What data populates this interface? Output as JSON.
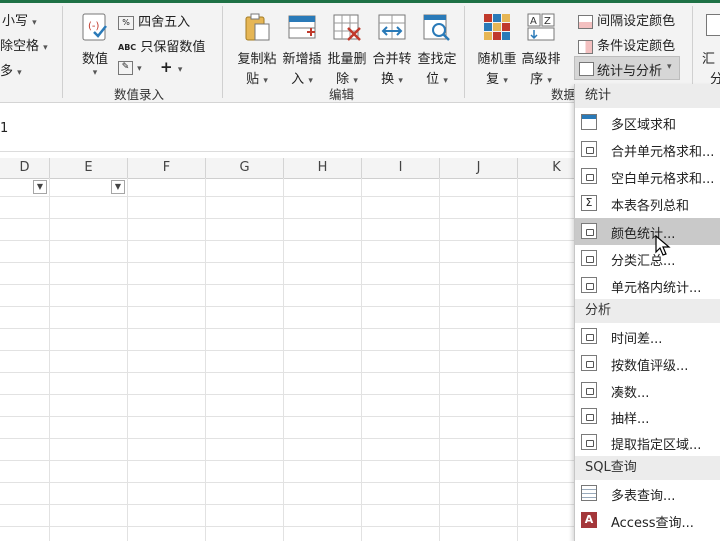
{
  "ribbon": {
    "left_partial": {
      "row1": "小写",
      "row2": "除空格",
      "row3": "多"
    },
    "numeric_group": {
      "value_button": "数值",
      "round_label": "四舍五入",
      "keep_value_label": "只保留数值",
      "plus": "+",
      "group_label": "数值录入"
    },
    "edit_group": {
      "buttons": [
        {
          "l1": "复制粘",
          "l2": "贴"
        },
        {
          "l1": "新增插",
          "l2": "入"
        },
        {
          "l1": "批量删",
          "l2": "除"
        },
        {
          "l1": "合并转",
          "l2": "换"
        },
        {
          "l1": "查找定",
          "l2": "位"
        }
      ],
      "group_label": "编辑"
    },
    "data_group": {
      "buttons": [
        {
          "l1": "随机重",
          "l2": "复"
        },
        {
          "l1": "高级排",
          "l2": "序"
        }
      ],
      "interval_color": "间隔设定颜色",
      "cond_color": "条件设定颜色",
      "stats_analysis": "统计与分析",
      "group_label": "数据"
    },
    "right_partial": {
      "l1": "汇",
      "l2": "分"
    }
  },
  "formula_bar": {
    "cell_ref": "1"
  },
  "grid": {
    "columns": [
      "D",
      "E",
      "F",
      "G",
      "H",
      "I",
      "J",
      "K"
    ]
  },
  "menu": {
    "sections": [
      {
        "title": "统计",
        "items": [
          {
            "label": "多区域求和",
            "icon": "table-icon"
          },
          {
            "label": "合并单元格求和...",
            "icon": "doc-icon"
          },
          {
            "label": "空白单元格求和...",
            "icon": "doc-icon"
          },
          {
            "label": "本表各列总和",
            "icon": "sigma-icon"
          },
          {
            "label": "颜色统计...",
            "icon": "doc-icon",
            "highlighted": true
          },
          {
            "label": "分类汇总...",
            "icon": "doc-icon"
          },
          {
            "label": "单元格内统计...",
            "icon": "doc-icon"
          }
        ]
      },
      {
        "title": "分析",
        "items": [
          {
            "label": "时间差...",
            "icon": "doc-icon"
          },
          {
            "label": "按数值评级...",
            "icon": "doc-icon"
          },
          {
            "label": "凑数...",
            "icon": "doc-icon"
          },
          {
            "label": "抽样...",
            "icon": "doc-icon"
          },
          {
            "label": "提取指定区域...",
            "icon": "doc-icon"
          }
        ]
      },
      {
        "title": "SQL查询",
        "items": [
          {
            "label": "多表查询...",
            "icon": "multi-table-icon"
          },
          {
            "label": "Access查询...",
            "icon": "access-icon"
          }
        ]
      }
    ]
  },
  "colors": {
    "accent_green": "#1e7145",
    "highlight": "#c9c9c9"
  }
}
